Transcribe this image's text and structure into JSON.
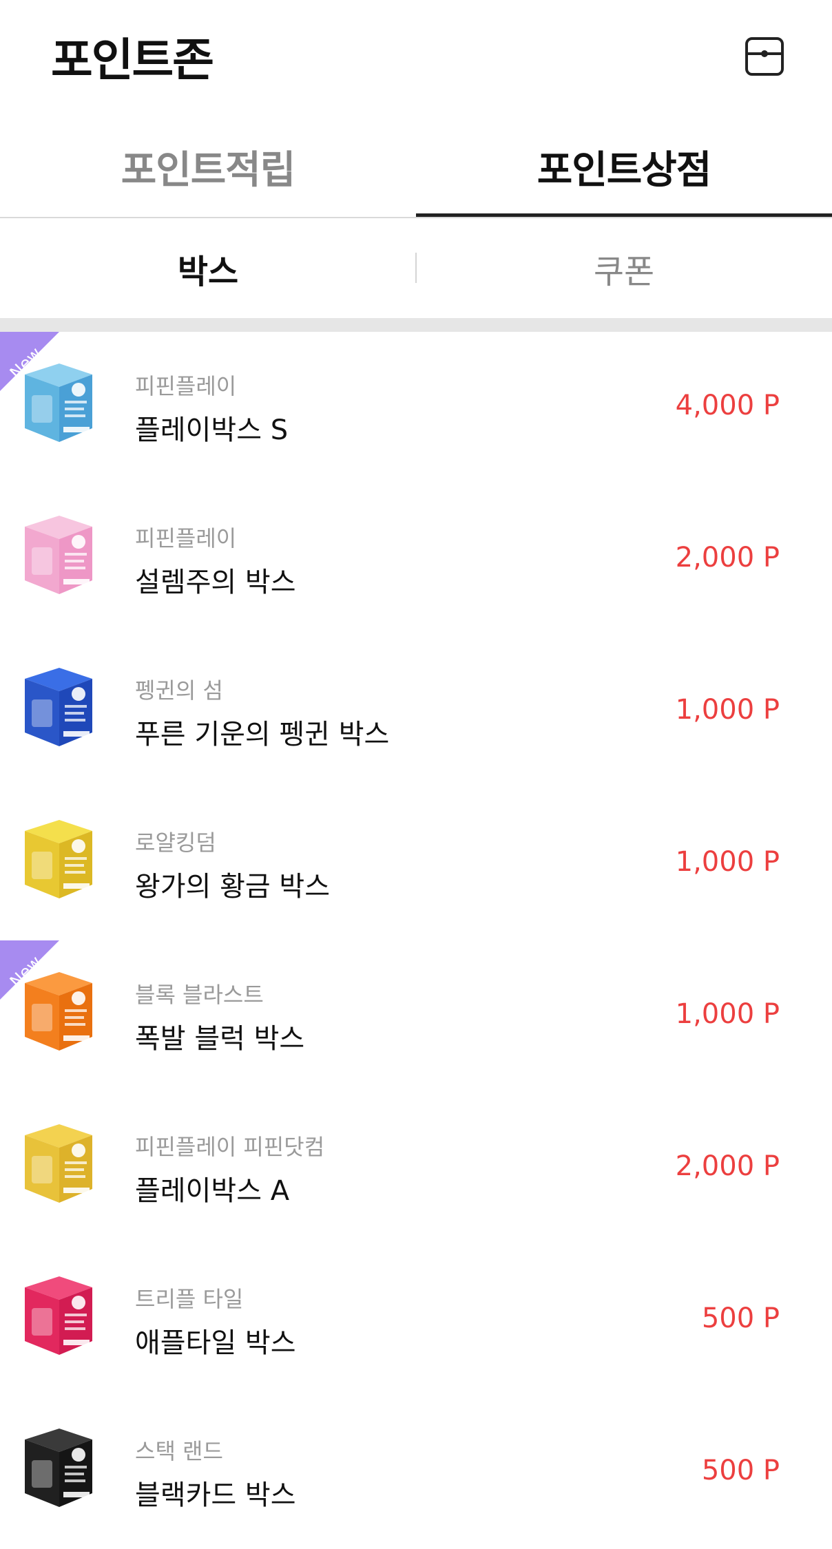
{
  "header": {
    "title": "포인트존",
    "action_icon": "wallet-icon"
  },
  "main_tabs": [
    {
      "label": "포인트적립",
      "active": false
    },
    {
      "label": "포인트상점",
      "active": true
    }
  ],
  "sub_tabs": [
    {
      "label": "박스",
      "active": true
    },
    {
      "label": "쿠폰",
      "active": false
    }
  ],
  "badge_label": "New",
  "colors": {
    "accent": "#111111",
    "price": "#ec3f3f",
    "new_badge": "#a78bf0"
  },
  "items": [
    {
      "brand": "피핀플레이",
      "name": "플레이박스 S",
      "price": "4,000 P",
      "is_new": true,
      "box_top": "#8fd0ef",
      "box_left": "#5fb4e0",
      "box_right": "#4aa0d6",
      "label_color": "#ffffff"
    },
    {
      "brand": "피핀플레이",
      "name": "설렘주의 박스",
      "price": "2,000 P",
      "is_new": false,
      "box_top": "#f7c5df",
      "box_left": "#f2a8cf",
      "box_right": "#ee97c6",
      "label_color": "#ffffff"
    },
    {
      "brand": "펭귄의 섬",
      "name": "푸른 기운의 펭귄 박스",
      "price": "1,000 P",
      "is_new": false,
      "box_top": "#3a6ee6",
      "box_left": "#2a56c8",
      "box_right": "#1f48b9",
      "label_color": "#ffffff"
    },
    {
      "brand": "로얄킹덤",
      "name": "왕가의 황금 박스",
      "price": "1,000 P",
      "is_new": false,
      "box_top": "#f4df4c",
      "box_left": "#e8c832",
      "box_right": "#dcb824",
      "label_color": "#5a4a10"
    },
    {
      "brand": "블록 블라스트",
      "name": "폭발 블럭 박스",
      "price": "1,000 P",
      "is_new": true,
      "box_top": "#fb9a40",
      "box_left": "#f37f1e",
      "box_right": "#e9700f",
      "label_color": "#ffffff"
    },
    {
      "brand": "피핀플레이 피핀닷컴",
      "name": "플레이박스 A",
      "price": "2,000 P",
      "is_new": false,
      "box_top": "#f3d250",
      "box_left": "#e8c23a",
      "box_right": "#ddb22a",
      "label_color": "#ffffff"
    },
    {
      "brand": "트리플 타일",
      "name": "애플타일 박스",
      "price": "500 P",
      "is_new": false,
      "box_top": "#f04b7c",
      "box_left": "#e2285e",
      "box_right": "#d21c52",
      "label_color": "#ffffff"
    },
    {
      "brand": "스택 랜드",
      "name": "블랙카드 박스",
      "price": "500 P",
      "is_new": false,
      "box_top": "#3a3a3a",
      "box_left": "#202020",
      "box_right": "#151515",
      "label_color": "#ffffff"
    }
  ]
}
